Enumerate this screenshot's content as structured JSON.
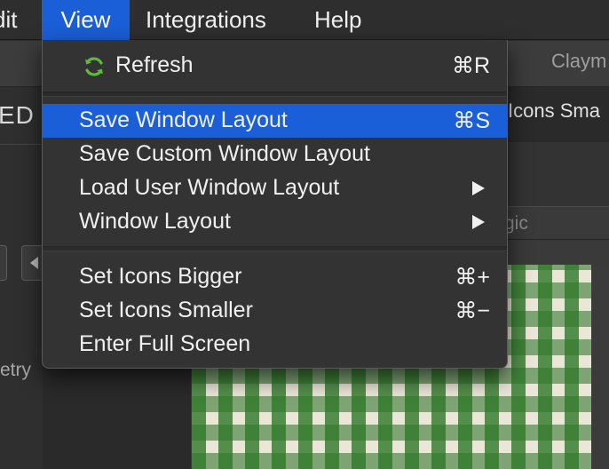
{
  "menubar": {
    "items": [
      {
        "label": "dit"
      },
      {
        "label": "View"
      },
      {
        "label": "Integrations"
      },
      {
        "label": "Help"
      }
    ]
  },
  "background": {
    "tab_label": "Claym",
    "left_heading": "ED",
    "left_label": "etry",
    "right_header": "Icons Sma",
    "right_field": "gic"
  },
  "view_menu": {
    "refresh": {
      "label": "Refresh",
      "shortcut": "⌘R",
      "icon": "refresh-icon",
      "icon_color": "#5dbb3a"
    },
    "items": [
      {
        "label": "Save Window Layout",
        "shortcut": "⌘S"
      },
      {
        "label": "Save Custom Window Layout",
        "shortcut": ""
      },
      {
        "label": "Load User Window Layout",
        "shortcut": ""
      },
      {
        "label": "Window Layout",
        "shortcut": ""
      },
      {
        "label": "Set Icons Bigger",
        "shortcut": "⌘+"
      },
      {
        "label": "Set Icons Smaller",
        "shortcut": "⌘−"
      },
      {
        "label": "Enter Full Screen",
        "shortcut": ""
      }
    ]
  },
  "colors": {
    "highlight": "#1a5fd8",
    "menu_bg": "#333333",
    "text": "#f0f0f0"
  }
}
